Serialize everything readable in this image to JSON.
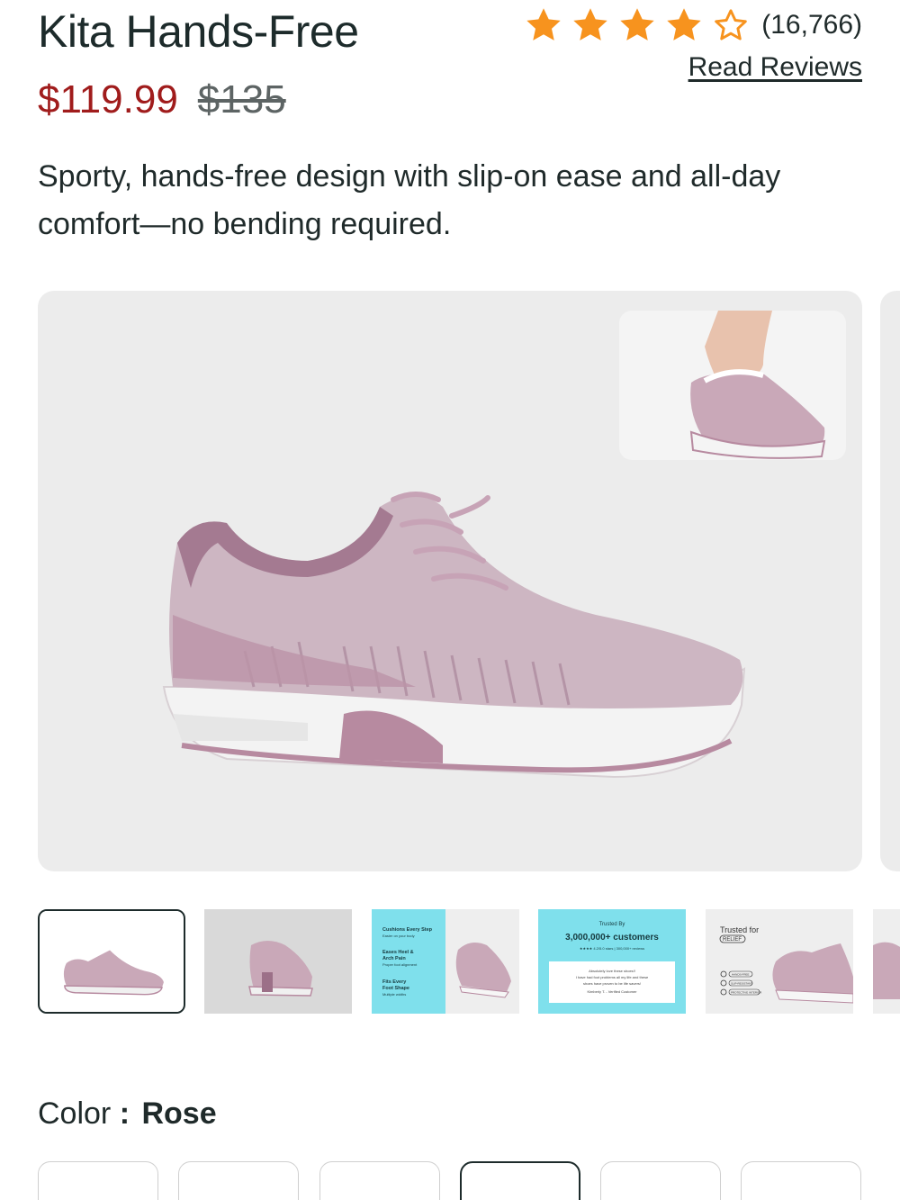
{
  "product": {
    "title": "Kita Hands-Free",
    "price_sale": "$119.99",
    "price_original": "$135",
    "description": "Sporty, hands-free design with slip-on ease and all-day comfort—no bending required."
  },
  "rating": {
    "stars": 4.5,
    "max_stars": 5,
    "count_label": "(16,766)",
    "read_reviews_label": "Read Reviews",
    "star_color": "#f7931e"
  },
  "gallery": {
    "main_image_icon": "shoe-side-view-image",
    "inset_image_icon": "shoe-on-foot-image",
    "thumbnails": [
      {
        "icon": "shoe-side-thumbnail",
        "selected": true
      },
      {
        "icon": "shoe-back-thumbnail",
        "selected": false
      },
      {
        "icon": "feature-callout-thumbnail",
        "selected": false,
        "lines": [
          "Cushions Every Step",
          "Easier on your body",
          "Eases Heel &",
          "Arch Pain",
          "Proper foot alignment",
          "Fits Every",
          "Foot Shape",
          "Multiple widths"
        ]
      },
      {
        "icon": "trust-badge-thumbnail",
        "selected": false,
        "heading": "Trusted By",
        "headline": "3,000,000+ customers",
        "stats": "★★★★ 4.2/5.0 stars | 300,000+ reviews",
        "quote_lines": [
          "Absolutely love these shoes!!",
          "I have had foot problems all my life and these",
          "shoes have proven to be life savers!",
          "Kimberly T. - Verified Customer"
        ]
      },
      {
        "icon": "relief-badge-thumbnail",
        "selected": false,
        "heading": "Trusted for",
        "badge": "RELIEF",
        "features": [
          "HANDS-FREE",
          "SLIP-RESISTANT",
          "PROTECTIVE INTERIOR"
        ]
      },
      {
        "icon": "shoe-partial-thumbnail",
        "selected": false
      }
    ]
  },
  "color": {
    "label": "Color",
    "separator": ":",
    "value": "Rose",
    "selected_index": 3,
    "swatch_count": 6
  },
  "colors": {
    "shoe_pink": "#c9a8b8",
    "shoe_dark": "#9c7088",
    "sole_white": "#f2f2f2",
    "thumb_cyan": "#7fe0ec",
    "price_red": "#a01c1c"
  }
}
